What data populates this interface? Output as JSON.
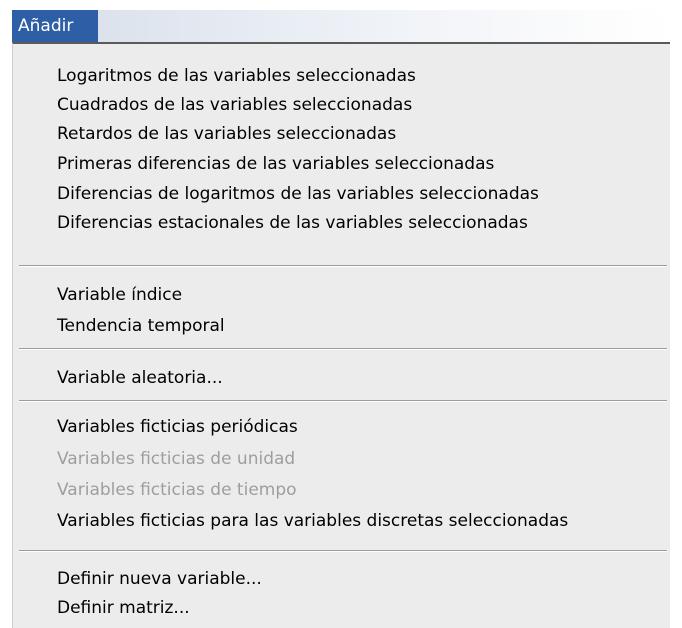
{
  "menubar": {
    "add_menu_label": "Añadir"
  },
  "menu": {
    "group1": [
      "Logaritmos de las variables seleccionadas",
      "Cuadrados de las variables seleccionadas",
      "Retardos de las variables seleccionadas",
      "Primeras diferencias de las variables seleccionadas",
      "Diferencias de logaritmos de las variables seleccionadas",
      "Diferencias estacionales de las variables seleccionadas"
    ],
    "group2": [
      "Variable índice",
      "Tendencia temporal"
    ],
    "group3": [
      "Variable aleatoria..."
    ],
    "group4": [
      "Variables ficticias periódicas",
      "Variables ficticias de unidad",
      "Variables ficticias de tiempo",
      "Variables ficticias para las variables discretas seleccionadas"
    ],
    "group5": [
      "Definir nueva variable...",
      "Definir matriz..."
    ]
  },
  "colors": {
    "highlight": "#2e5ea6",
    "menu_background": "#ececec",
    "disabled_text": "#9e9e9e"
  }
}
